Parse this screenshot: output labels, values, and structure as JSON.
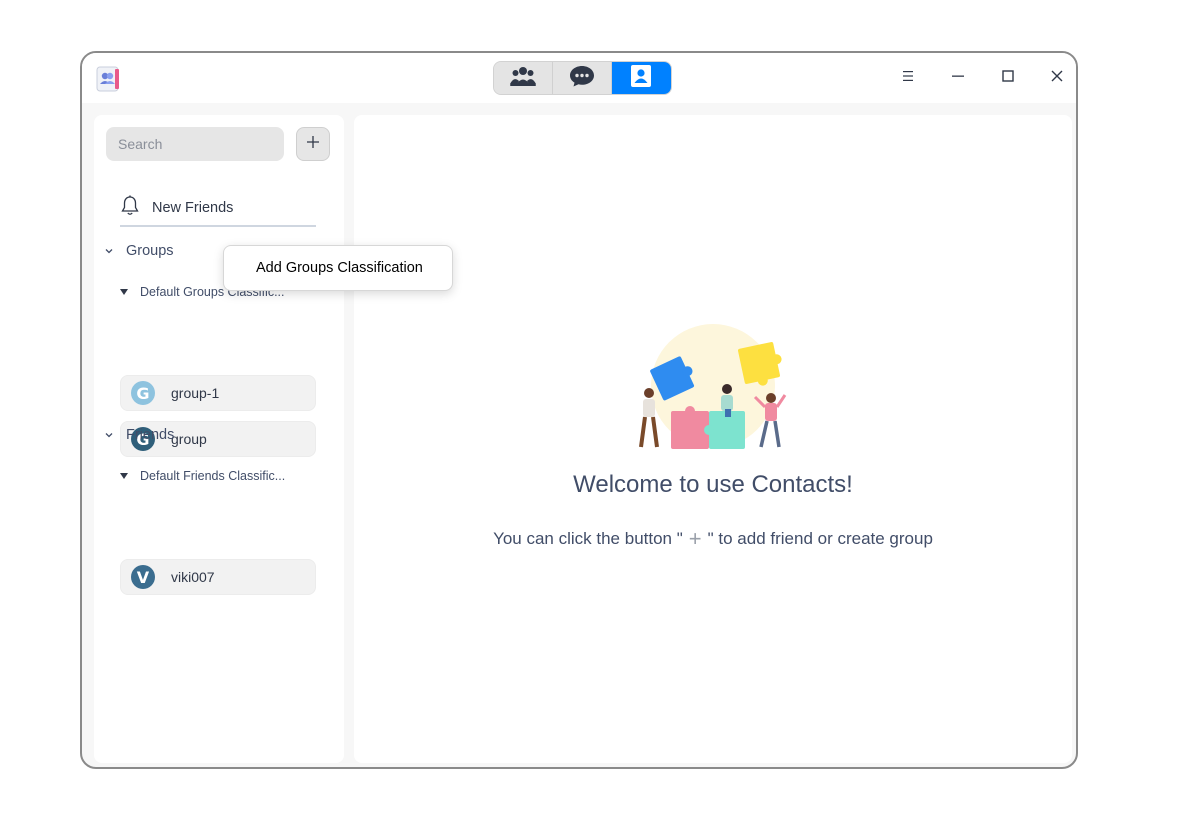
{
  "titlebar": {
    "view_tabs": [
      {
        "icon": "people-group-icon",
        "active": false
      },
      {
        "icon": "chat-bubble-icon",
        "active": false
      },
      {
        "icon": "contact-card-icon",
        "active": true
      }
    ],
    "accent_color": "#0081ff"
  },
  "sidebar": {
    "search_placeholder": "Search",
    "new_friends_label": "New Friends",
    "groups_label": "Groups",
    "groups_classification": "Default Groups Classific...",
    "groups": [
      {
        "name": "group-1",
        "initial": "G",
        "color": "#8ec3df"
      },
      {
        "name": "group",
        "initial": "G",
        "color": "#2f5f7a"
      }
    ],
    "friends_label": "Friends",
    "friends_classification": "Default Friends Classific...",
    "friends": [
      {
        "name": "viki007",
        "initial": "V",
        "color": "#3b6d8f"
      }
    ]
  },
  "main": {
    "welcome_title": "Welcome to use Contacts!",
    "hint_before": "You can click the button \"",
    "hint_plus": "+",
    "hint_after": "\" to add friend or create group"
  },
  "context_menu": {
    "item": "Add Groups Classification"
  }
}
